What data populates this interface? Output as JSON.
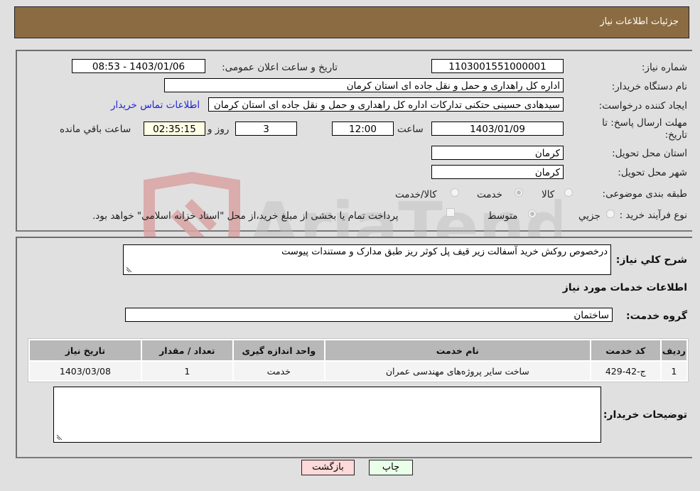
{
  "header": {
    "title": "جزئیات اطلاعات نیاز"
  },
  "form": {
    "need_number": {
      "label": "شماره نیاز:",
      "value": "1103001551000001"
    },
    "announce_datetime": {
      "label": "تاریخ و ساعت اعلان عمومی:",
      "value": "1403/01/06 - 08:53"
    },
    "buyer_org": {
      "label": "نام دستگاه خریدار:",
      "value": "اداره کل راهداری و حمل و نقل جاده ای استان کرمان"
    },
    "requester": {
      "label": "ایجاد کننده درخواست:",
      "value": "سیدهادی حسینی حتکنی تدارکات اداره کل راهداری و حمل و نقل جاده ای استان کرمان"
    },
    "buyer_contact_link": "اطلاعات تماس خریدار",
    "deadline": {
      "label": "مهلت ارسال پاسخ: تا تاریخ:",
      "date": "1403/01/09",
      "time_label": "ساعت",
      "time": "12:00",
      "days": "3",
      "days_label": "روز و",
      "remaining": "02:35:15",
      "remaining_label": "ساعت باقي مانده"
    },
    "province": {
      "label": "استان محل تحویل:",
      "value": "کرمان"
    },
    "city": {
      "label": "شهر محل تحویل:",
      "value": "کرمان"
    },
    "category": {
      "label": "طبقه بندی موضوعی:",
      "options": [
        "کالا",
        "خدمت",
        "کالا/خدمت"
      ],
      "selected": "خدمت"
    },
    "purchase_type": {
      "label": "نوع فرآیند خرید :",
      "options": [
        "جزيي",
        "متوسط"
      ],
      "selected": "متوسط",
      "treasury_note": "پرداخت تمام یا بخشی از مبلغ خرید،از محل \"اسناد خزانه اسلامی\" خواهد بود."
    }
  },
  "details": {
    "description_label": "شرح کلي نياز:",
    "description": "درخصوص روکش خرید آسفالت زیر قیف پل کوثر ریز طبق مدارک و مستندات پیوست",
    "services_heading": "اطلاعات خدمات مورد نیاز",
    "service_group_label": "گروه خدمت:",
    "service_group": "ساختمان",
    "table": {
      "headers": [
        "ردیف",
        "کد خدمت",
        "نام خدمت",
        "واحد اندازه گیری",
        "تعداد / مقدار",
        "تاریخ نیاز"
      ],
      "rows": [
        [
          "1",
          "ج-42-429",
          "ساخت سایر پروژه‌های مهندسی عمران",
          "خدمت",
          "1",
          "1403/03/08"
        ]
      ]
    },
    "buyer_notes_label": "توضیحات خریدار:",
    "buyer_notes": ""
  },
  "buttons": {
    "print": "چاپ",
    "back": "بازگشت"
  },
  "watermark": {
    "text": "AriaTender.neT"
  }
}
